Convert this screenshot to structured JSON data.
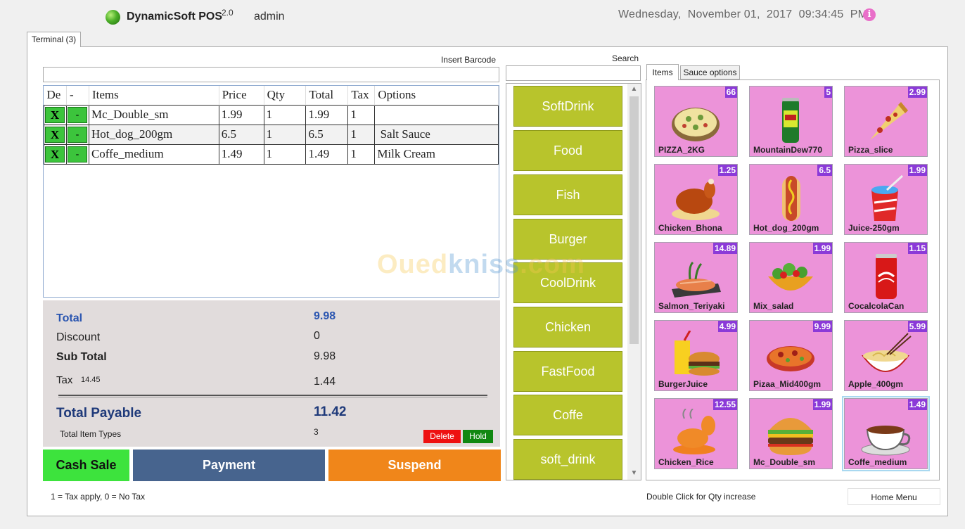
{
  "header": {
    "app_name": "DynamicSoft POS",
    "app_version": "2.0",
    "user": "admin",
    "datetime": "Wednesday,  November 01,  2017  09:34:45  PM",
    "info_glyph": "i"
  },
  "tabs": {
    "terminal": "Terminal (3)"
  },
  "barcode": {
    "label": "Insert Barcode"
  },
  "order_table": {
    "columns": [
      "De",
      "-",
      "Items",
      "Price",
      "Qty",
      "Total",
      "Tax",
      "Options"
    ],
    "rows": [
      {
        "del": "X",
        "minus": "-",
        "item": "Mc_Double_sm",
        "price": "1.99",
        "qty": "1",
        "total": "1.99",
        "tax": "1",
        "options": ""
      },
      {
        "del": "X",
        "minus": "-",
        "item": "Hot_dog_200gm",
        "price": "6.5",
        "qty": "1",
        "total": "6.5",
        "tax": "1",
        "options": " Salt Sauce"
      },
      {
        "del": "X",
        "minus": "-",
        "item": "Coffe_medium",
        "price": "1.49",
        "qty": "1",
        "total": "1.49",
        "tax": "1",
        "options": "Milk Cream"
      }
    ]
  },
  "totals": {
    "total_label": "Total",
    "total_value": "9.98",
    "discount_label": "Discount",
    "discount_value": "0",
    "subtotal_label": "Sub Total",
    "subtotal_value": "9.98",
    "tax_label": "Tax",
    "tax_rate": "14.45",
    "tax_value": "1.44",
    "payable_label": "Total Payable",
    "payable_value": "11.42",
    "item_types_label": "Total Item Types",
    "item_types_value": "3",
    "delete_label": "Delete",
    "hold_label": "Hold"
  },
  "actions": {
    "cash_sale": "Cash Sale",
    "payment": "Payment",
    "suspend": "Suspend"
  },
  "tax_note": "1 = Tax apply, 0 = No Tax",
  "search": {
    "label": "Search"
  },
  "categories": [
    "SoftDrink",
    "Food",
    "Fish",
    "Burger",
    "CoolDrink",
    "Chicken",
    "FastFood",
    "Coffe",
    "soft_drink"
  ],
  "item_tabs": {
    "items": "Items",
    "sauce": "Sauce options"
  },
  "items": [
    {
      "name": "PIZZA_2KG",
      "price": "66",
      "icon": "pizza-icon"
    },
    {
      "name": "MountainDew770",
      "price": "5",
      "icon": "soda-can-icon"
    },
    {
      "name": "Pizza_slice",
      "price": "2.99",
      "icon": "pizza-slice-icon"
    },
    {
      "name": "Chicken_Bhona",
      "price": "1.25",
      "icon": "roast-chicken-icon"
    },
    {
      "name": "Hot_dog_200gm",
      "price": "6.5",
      "icon": "hotdog-icon"
    },
    {
      "name": "Juice-250gm",
      "price": "1.99",
      "icon": "juice-cup-icon"
    },
    {
      "name": "Salmon_Teriyaki",
      "price": "14.89",
      "icon": "salmon-icon"
    },
    {
      "name": "Mix_salad",
      "price": "1.99",
      "icon": "salad-icon"
    },
    {
      "name": "CocalcolaCan",
      "price": "1.15",
      "icon": "cola-can-icon"
    },
    {
      "name": "BurgerJuice",
      "price": "4.99",
      "icon": "burger-juice-icon"
    },
    {
      "name": "Pizaa_Mid400gm",
      "price": "9.99",
      "icon": "pizza-plate-icon"
    },
    {
      "name": "Apple_400gm",
      "price": "5.99",
      "icon": "noodle-bowl-icon"
    },
    {
      "name": "Chicken_Rice",
      "price": "12.55",
      "icon": "chicken-leg-icon"
    },
    {
      "name": "Mc_Double_sm",
      "price": "1.99",
      "icon": "burger-icon"
    },
    {
      "name": "Coffe_medium",
      "price": "1.49",
      "icon": "coffee-cup-icon"
    }
  ],
  "qty_hint": "Double Click for Qty increase",
  "home_menu": "Home Menu",
  "watermark": {
    "part1": "Oued",
    "part2": "kniss",
    "part3": ".com"
  },
  "colors": {
    "category_button": "#b8c42c",
    "item_tile": "#ec93d9",
    "price_badge": "#8b3ad8",
    "cash_sale": "#3de33d",
    "payment": "#47648e",
    "suspend": "#f0861a",
    "delete": "#ee1111",
    "hold": "#118811"
  }
}
